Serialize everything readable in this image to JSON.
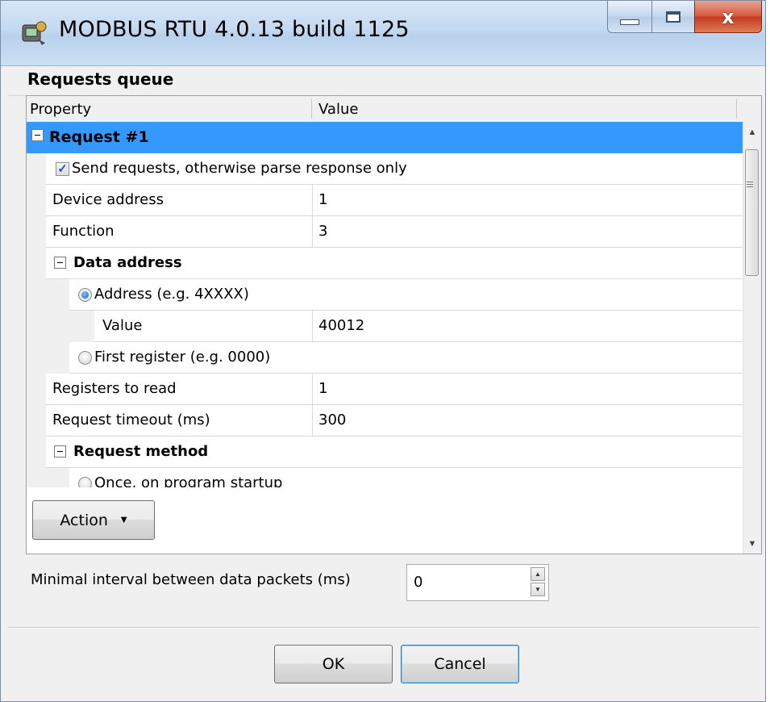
{
  "window": {
    "title": "MODBUS RTU 4.0.13 build 1125",
    "close_label": "x"
  },
  "group": {
    "title": "Requests queue"
  },
  "grid": {
    "columns": {
      "property": "Property",
      "value": "Value"
    },
    "request": {
      "label": "Request #1",
      "send_requests": "Send requests, otherwise parse response only",
      "send_requests_checked": true,
      "device_address": {
        "label": "Device address",
        "value": "1"
      },
      "function": {
        "label": "Function",
        "value": "3"
      },
      "data_address": {
        "label": "Data address",
        "address_option": "Address (e.g. 4XXXX)",
        "address_selected": true,
        "value": {
          "label": "Value",
          "value": "40012"
        },
        "first_register_option": "First register (e.g. 0000)"
      },
      "registers_to_read": {
        "label": "Registers to read",
        "value": "1"
      },
      "request_timeout": {
        "label": "Request timeout (ms)",
        "value": "300"
      },
      "request_method": {
        "label": "Request method",
        "once_option": "Once, on program startup"
      }
    }
  },
  "actions": {
    "action_label": "Action"
  },
  "interval": {
    "label": "Minimal interval between data packets (ms)",
    "value": "0"
  },
  "footer": {
    "ok_label": "OK",
    "cancel_label": "Cancel"
  }
}
